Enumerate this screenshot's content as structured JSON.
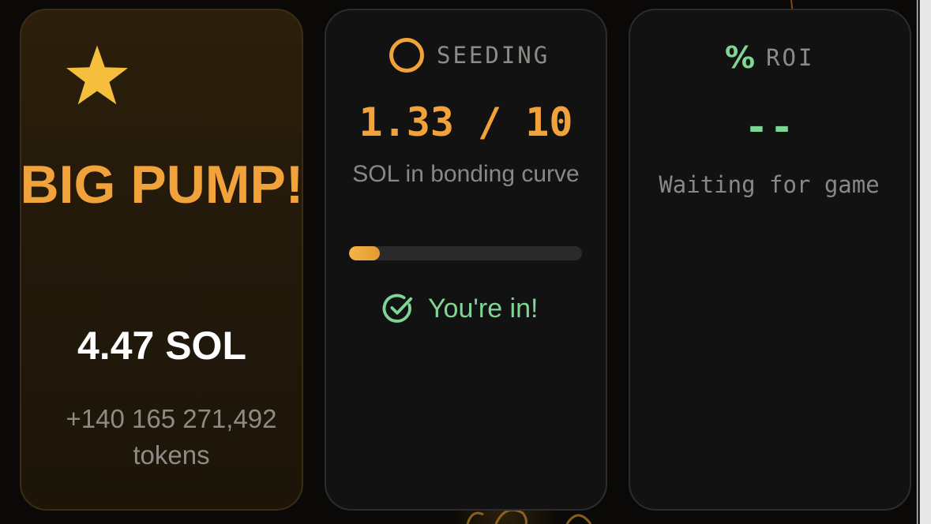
{
  "colors": {
    "accent_orange": "#f2a23a",
    "accent_green": "#7ed694",
    "muted_text": "#8a8884",
    "card_background": "#121212"
  },
  "result_card": {
    "icon": "star-icon",
    "headline": "BIG PUMP!",
    "sol_amount": "4.47 SOL",
    "tokens": "+140 165 271,492 tokens"
  },
  "seeding_card": {
    "icon": "circle-icon",
    "label": "SEEDING",
    "value": "1.33 / 10",
    "caption": "SOL in bonding curve",
    "progress_fraction": 0.133,
    "status_icon": "check-circle-icon",
    "status": "You're in!"
  },
  "roi_card": {
    "icon": "percent-icon",
    "icon_glyph": "%",
    "label": "ROI",
    "value": "--",
    "caption": "Waiting for game"
  }
}
